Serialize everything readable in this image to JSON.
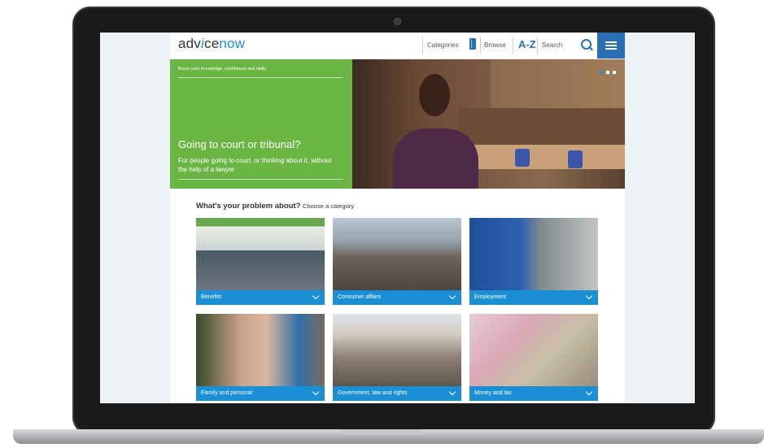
{
  "header": {
    "logo_prefix": "adv",
    "logo_i": "i",
    "logo_ce": "ce",
    "logo_now": "now",
    "nav_categories": "Categories",
    "nav_browse": "Browse",
    "nav_az": "A-Z",
    "nav_search": "Search"
  },
  "hero": {
    "kicker": "Boost your knowledge, confidence and skills",
    "title": "Going to court or tribunal?",
    "subtitle": "For people going to court, or thinking about it, without the help of a lawyer"
  },
  "problem": {
    "heading": "What's your problem about?",
    "subheading": "Choose a category"
  },
  "categories": [
    {
      "label": "Benefits",
      "image": "jobcentre plus shopfront"
    },
    {
      "label": "Consumer affairs",
      "image": "busy shopping street"
    },
    {
      "label": "Employment",
      "image": "man in front of garage services sign"
    },
    {
      "label": "Family and personal",
      "image": "father and child"
    },
    {
      "label": "Government, law and rights",
      "image": "royal courts of justice"
    },
    {
      "label": "Money and tax",
      "image": "coins and receipts"
    }
  ],
  "colors": {
    "accent_blue": "#1a8fd5",
    "nav_blue": "#2a6fb3",
    "hero_green": "#6bb544"
  },
  "icons": [
    "book-icon",
    "search-icon",
    "menu-icon",
    "chevron-down-icon"
  ]
}
